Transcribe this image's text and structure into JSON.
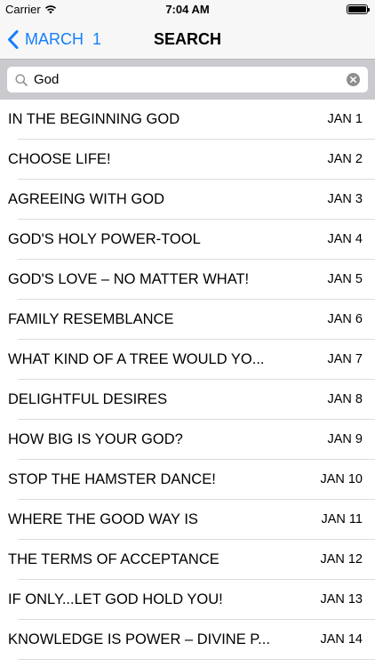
{
  "status_bar": {
    "carrier": "Carrier",
    "time": "7:04 AM"
  },
  "nav": {
    "back_label": "MARCH  1",
    "title": "SEARCH"
  },
  "search": {
    "value": "God",
    "placeholder": "Search"
  },
  "colors": {
    "accent": "#157efb",
    "search_bar_background": "#c9c9ce"
  },
  "icons": {
    "back": "chevron-left-icon",
    "search": "magnifier-icon",
    "clear": "clear-x-icon",
    "wifi": "wifi-icon",
    "battery": "battery-icon"
  },
  "results": [
    {
      "title": "IN THE BEGINNING GOD",
      "date": "JAN 1"
    },
    {
      "title": "CHOOSE LIFE!",
      "date": "JAN 2"
    },
    {
      "title": "AGREEING WITH GOD",
      "date": "JAN 3"
    },
    {
      "title": "GOD'S HOLY POWER-TOOL",
      "date": "JAN 4"
    },
    {
      "title": "GOD'S LOVE – NO MATTER WHAT!",
      "date": "JAN 5"
    },
    {
      "title": "FAMILY RESEMBLANCE",
      "date": "JAN 6"
    },
    {
      "title": "WHAT KIND OF A TREE WOULD YO...",
      "date": "JAN 7"
    },
    {
      "title": "DELIGHTFUL DESIRES",
      "date": "JAN 8"
    },
    {
      "title": "HOW BIG IS YOUR GOD?",
      "date": "JAN 9"
    },
    {
      "title": "STOP THE HAMSTER DANCE!",
      "date": "JAN 10"
    },
    {
      "title": "WHERE THE GOOD WAY IS",
      "date": "JAN 11"
    },
    {
      "title": "THE TERMS OF ACCEPTANCE",
      "date": "JAN 12"
    },
    {
      "title": "IF ONLY...LET GOD HOLD YOU!",
      "date": "JAN 13"
    },
    {
      "title": "KNOWLEDGE IS POWER – DIVINE P...",
      "date": "JAN 14"
    }
  ]
}
